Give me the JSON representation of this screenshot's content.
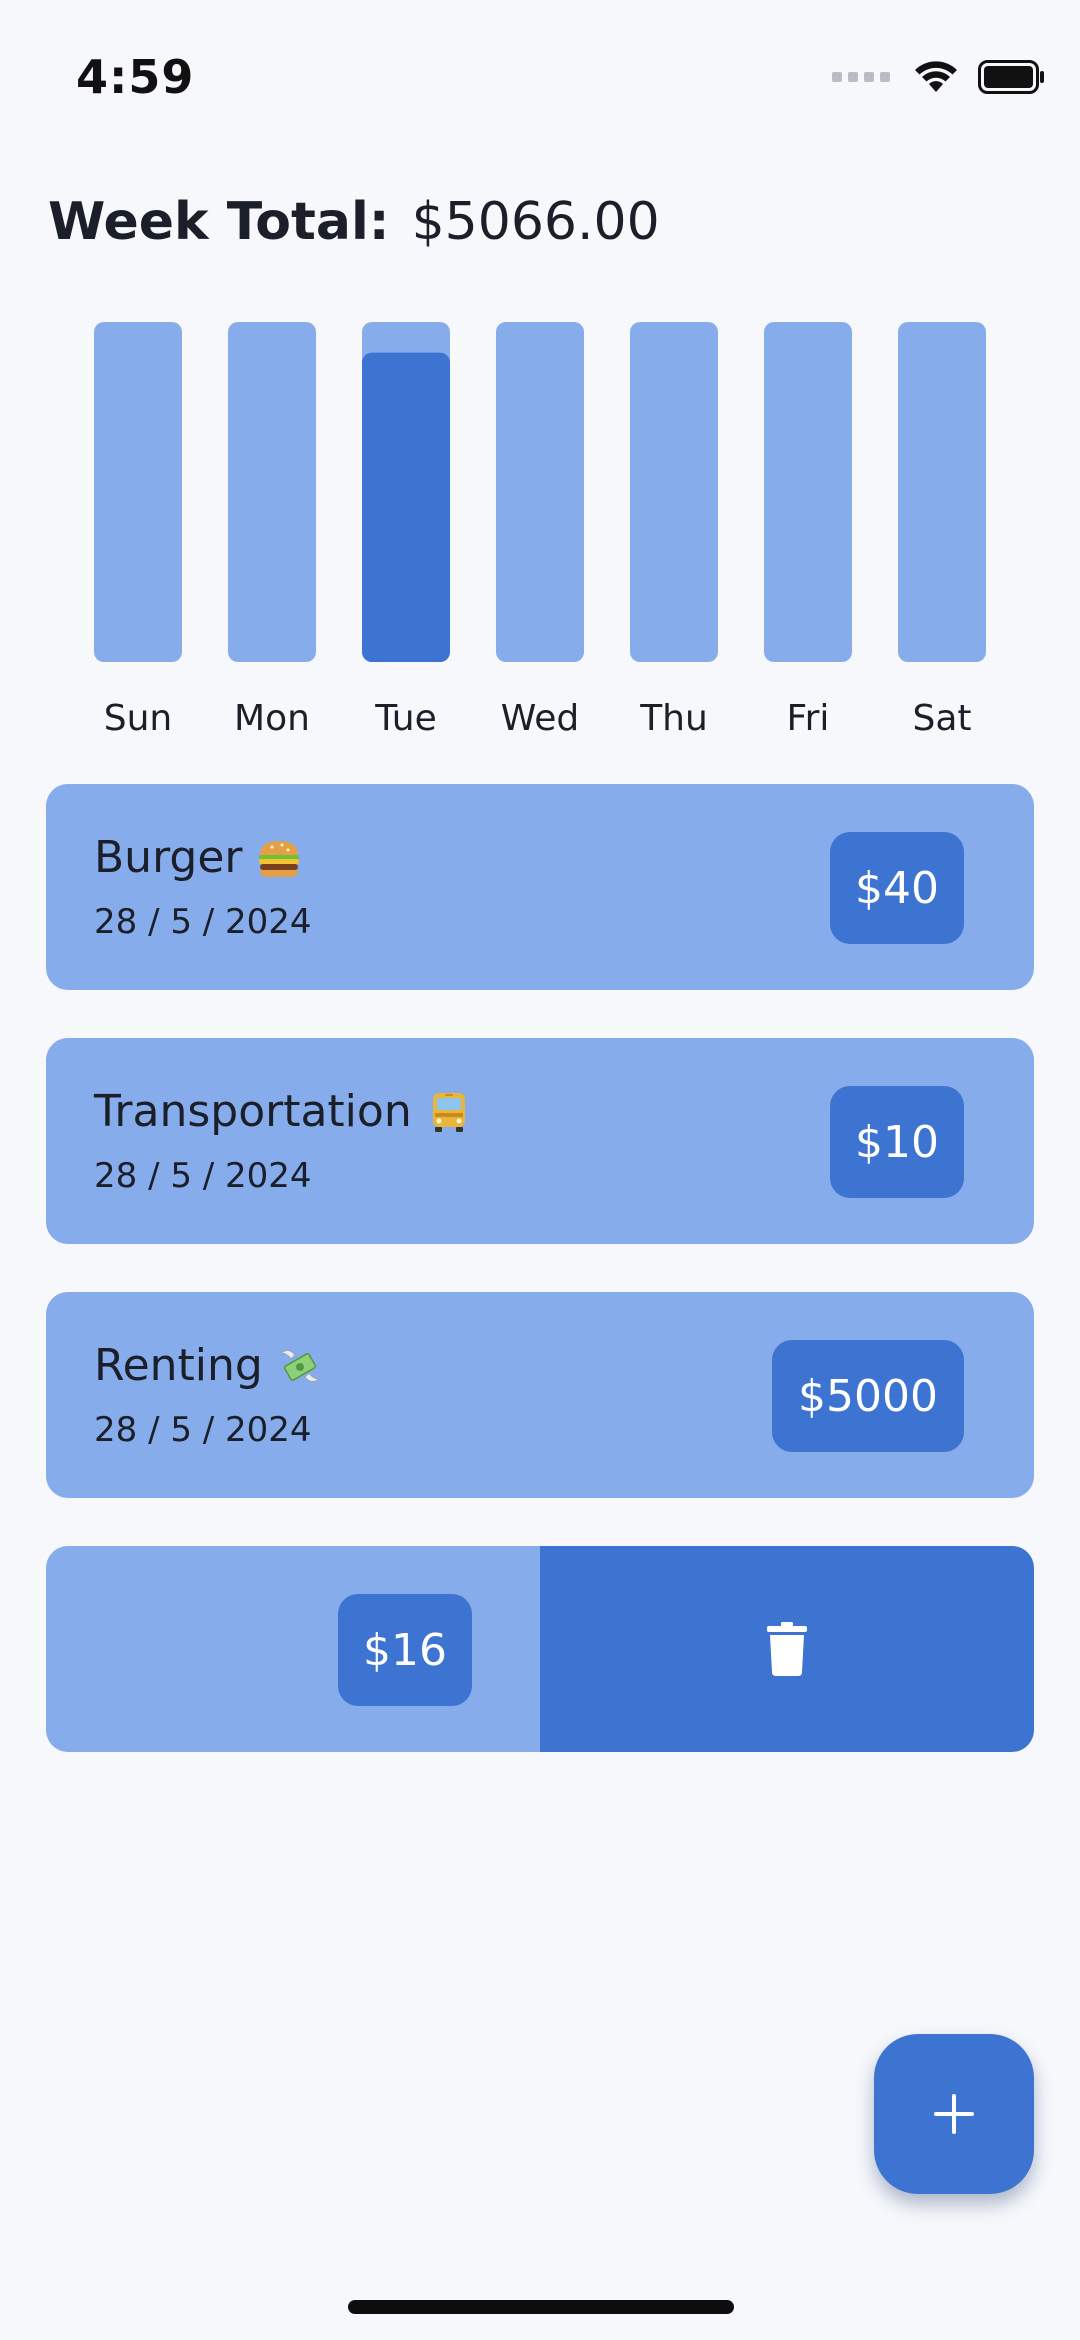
{
  "status_bar": {
    "time": "4:59"
  },
  "summary": {
    "label": "Week Total:",
    "value": "$5066.00"
  },
  "chart_data": {
    "type": "bar",
    "categories": [
      "Sun",
      "Mon",
      "Tue",
      "Wed",
      "Thu",
      "Fri",
      "Sat"
    ],
    "values": [
      0,
      0,
      5066,
      0,
      0,
      0,
      0
    ],
    "max": 5066,
    "highlight_fraction": 0.91,
    "colors": {
      "track": "#87acec",
      "fill": "#3d74d1"
    }
  },
  "expenses": [
    {
      "title": "Burger",
      "date": "28 / 5 / 2024",
      "amount": "$40",
      "icon": "burger-emoji"
    },
    {
      "title": "Transportation",
      "date": "28 / 5 / 2024",
      "amount": "$10",
      "icon": "bus-emoji"
    },
    {
      "title": "Renting",
      "date": "28 / 5 / 2024",
      "amount": "$5000",
      "icon": "money-wings-emoji"
    },
    {
      "amount": "$16",
      "delete_icon": "trash-icon"
    }
  ],
  "fab": {
    "icon": "plus-icon"
  },
  "colors": {
    "background": "#f6f8fc",
    "card": "#87acec",
    "accent": "#3d74d1"
  }
}
